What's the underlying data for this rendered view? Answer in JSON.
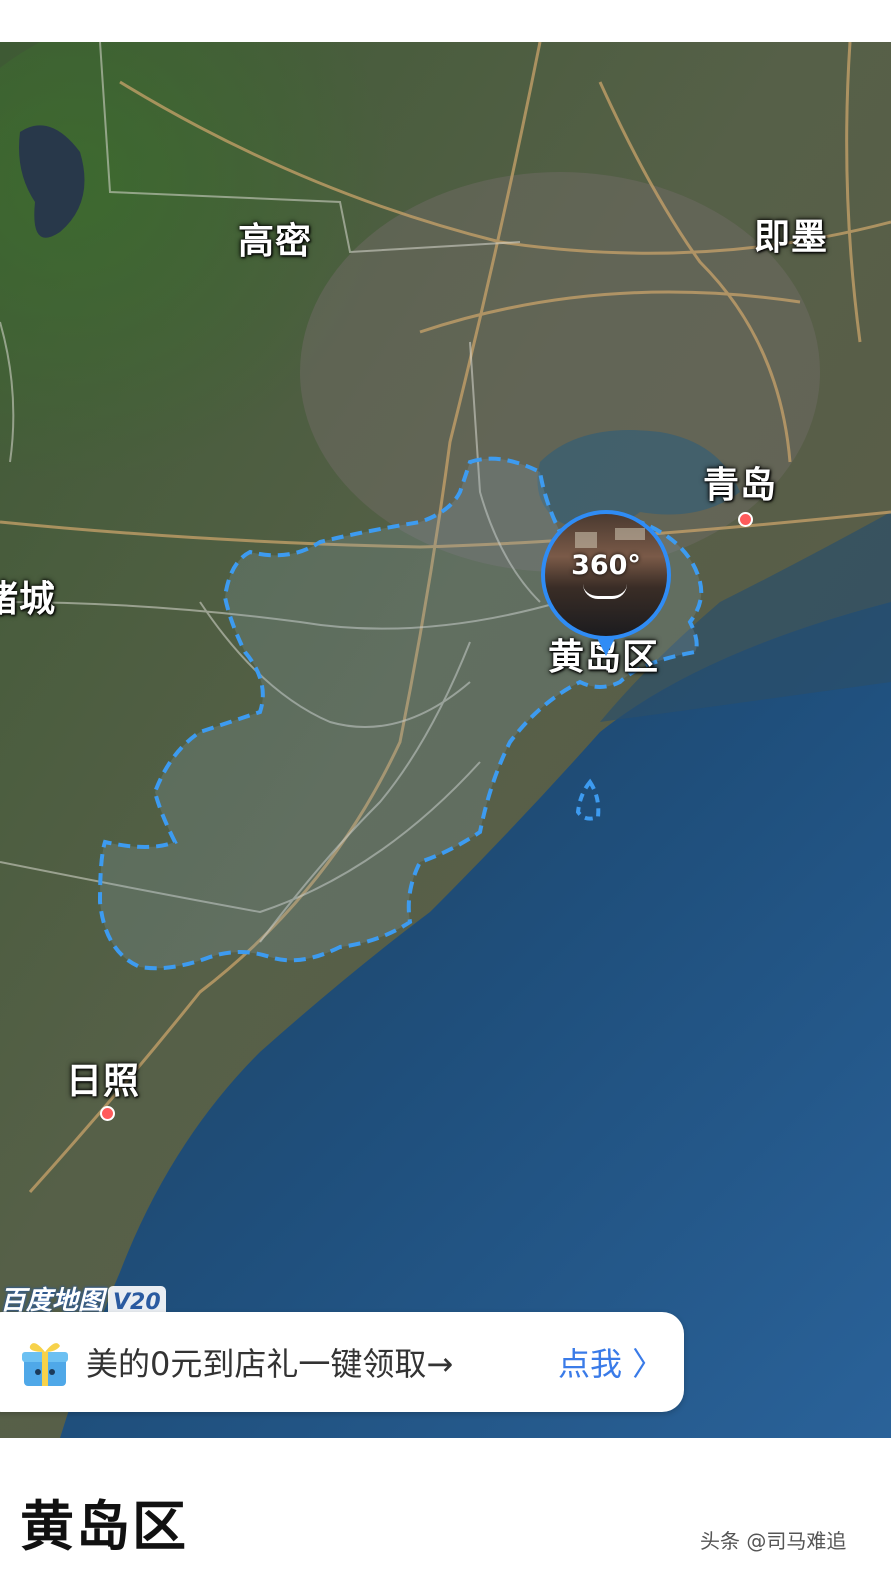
{
  "map": {
    "labels": {
      "gaomi": "高密",
      "jimo": "即墨",
      "qingdao": "青岛",
      "zhucheng": "诸城",
      "huangdao": "黄岛区",
      "rizhao": "日照"
    },
    "panorama_badge": "360°",
    "highlight_color": "#3d9bf0",
    "watermark": {
      "brand": "百度地图",
      "version": "V20"
    }
  },
  "promo": {
    "text": "美的0元到店礼一键领取→",
    "cta": "点我 〉"
  },
  "place": {
    "title": "黄岛区"
  },
  "source": "头条 @司马难追"
}
